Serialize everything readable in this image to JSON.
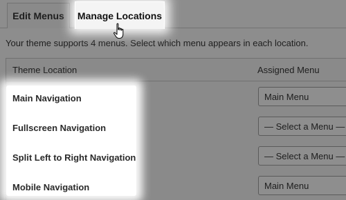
{
  "tabs": [
    {
      "label": "Edit Menus",
      "active": false
    },
    {
      "label": "Manage Locations",
      "active": true
    }
  ],
  "description": "Your theme supports 4 menus. Select which menu appears in each location.",
  "table": {
    "col_location": "Theme Location",
    "col_menu": "Assigned Menu",
    "rows": [
      {
        "location": "Main Navigation",
        "menu": "Main Menu"
      },
      {
        "location": "Fullscreen Navigation",
        "menu": "— Select a Menu —"
      },
      {
        "location": "Split Left to Right Navigation",
        "menu": "— Select a Menu —"
      },
      {
        "location": "Mobile Navigation",
        "menu": "Main Menu"
      }
    ]
  },
  "icons": {
    "cursor": "hand-pointer-icon"
  }
}
